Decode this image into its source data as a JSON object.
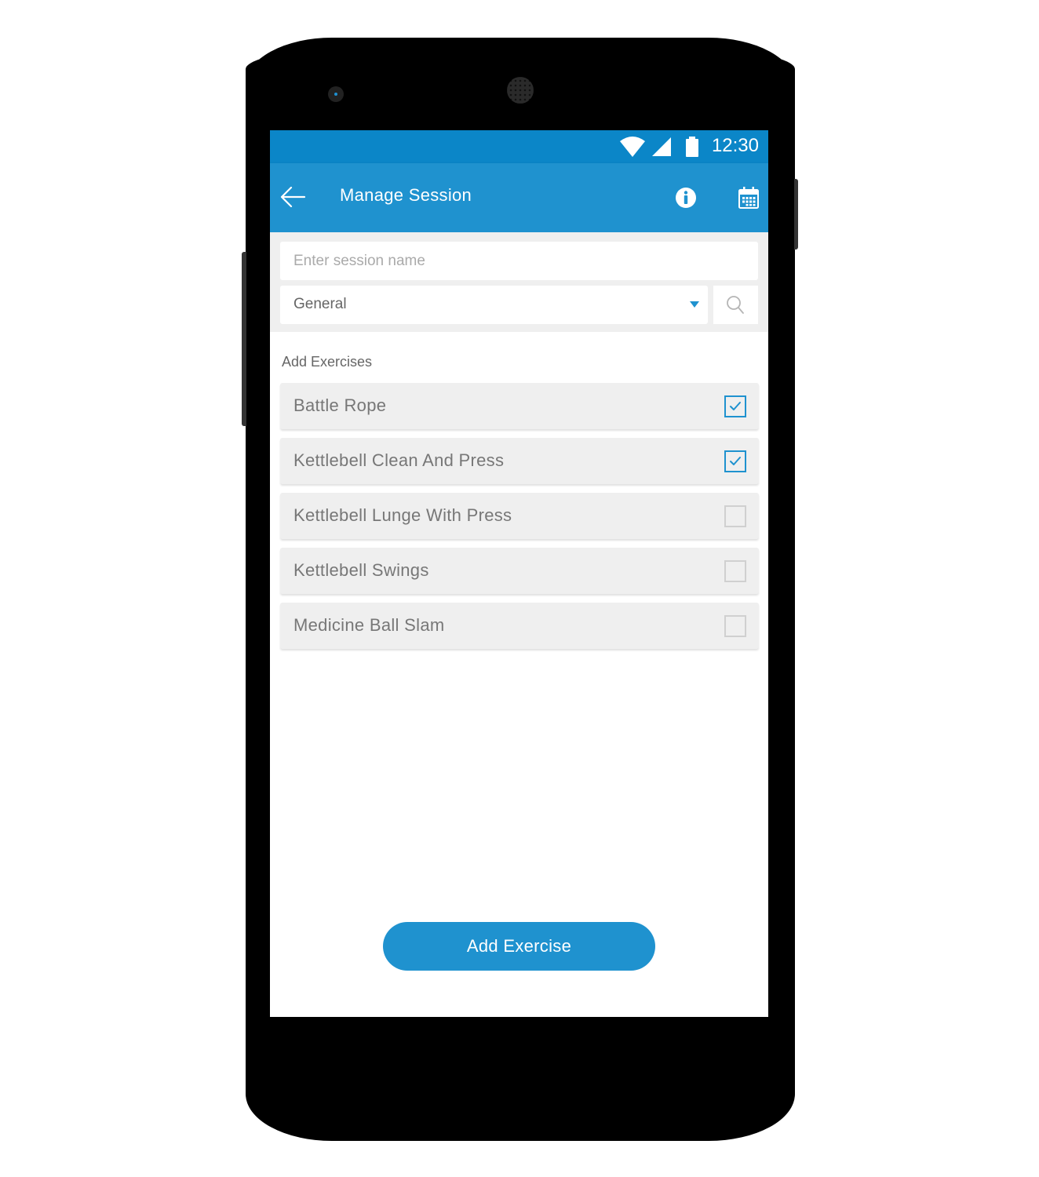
{
  "status_bar": {
    "time": "12:30",
    "icons": [
      "wifi-icon",
      "cell-signal-icon",
      "battery-icon"
    ]
  },
  "app_bar": {
    "title": "Manage Session",
    "back_icon": "arrow-left-icon",
    "actions": [
      "info-icon",
      "calendar-icon"
    ]
  },
  "form": {
    "session_name": {
      "value": "",
      "placeholder": "Enter session name"
    },
    "category": {
      "selected": "General"
    },
    "search_icon": "search-icon"
  },
  "exercises": {
    "section_label": "Add Exercises",
    "items": [
      {
        "name": "Battle Rope",
        "checked": true
      },
      {
        "name": "Kettlebell Clean And Press",
        "checked": true
      },
      {
        "name": "Kettlebell Lunge With Press",
        "checked": false
      },
      {
        "name": "Kettlebell Swings",
        "checked": false
      },
      {
        "name": "Medicine Ball Slam",
        "checked": false
      }
    ]
  },
  "actions": {
    "add_exercise_label": "Add Exercise"
  },
  "colors": {
    "status_bar": "#0b86c8",
    "app_bar": "#1f92cf",
    "accent": "#1f92cf",
    "form_bg": "#efefef",
    "item_bg": "#efefef",
    "text_secondary": "#777777"
  }
}
